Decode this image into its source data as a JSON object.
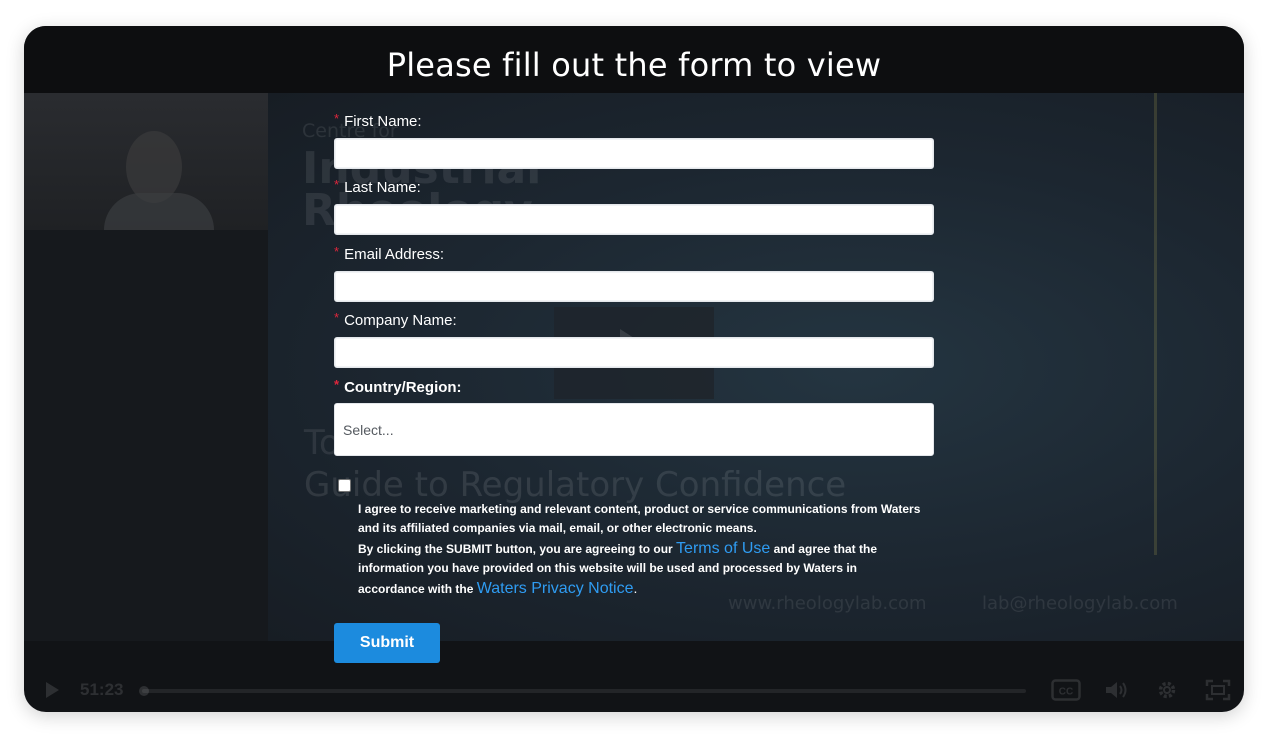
{
  "overlay": {
    "title": "Please fill out the form to view"
  },
  "form": {
    "required_marker": "*",
    "first_name_label": "First Name:",
    "last_name_label": "Last Name:",
    "email_label": "Email Address:",
    "company_label": "Company Name:",
    "country_label": "Country/Region:",
    "country_placeholder": "Select...",
    "consent_text_1": "I agree to receive marketing and relevant content, product or service communications from Waters and its affiliated companies via mail, email, or other electronic means.",
    "consent_text_2_pre": "By clicking the SUBMIT button, you are agreeing to our",
    "terms_link": "Terms of Use",
    "consent_text_2_mid": "and agree that the information you have provided on this website will be used and processed by Waters in accordance with the",
    "privacy_link": "Waters Privacy Notice",
    "consent_text_2_end": ".",
    "submit_label": "Submit",
    "link_color": "#2f9cf2",
    "submit_color": "#1c8bde",
    "required_color": "#e0263c"
  },
  "video": {
    "background_slide": {
      "line_1": "Centre for",
      "line_2": "Industrial",
      "line_3": "Rheology",
      "line_4": "To",
      "line_5": "Guide to Regulatory Confidence",
      "website": "www.rheologylab.com",
      "email": "lab@rheologylab.com"
    },
    "controls": {
      "time": "51:23",
      "play_icon": "play-icon",
      "cc_icon": "closed-captions-icon",
      "volume_icon": "volume-icon",
      "settings_icon": "gear-icon",
      "fullscreen_icon": "fullscreen-icon"
    }
  }
}
